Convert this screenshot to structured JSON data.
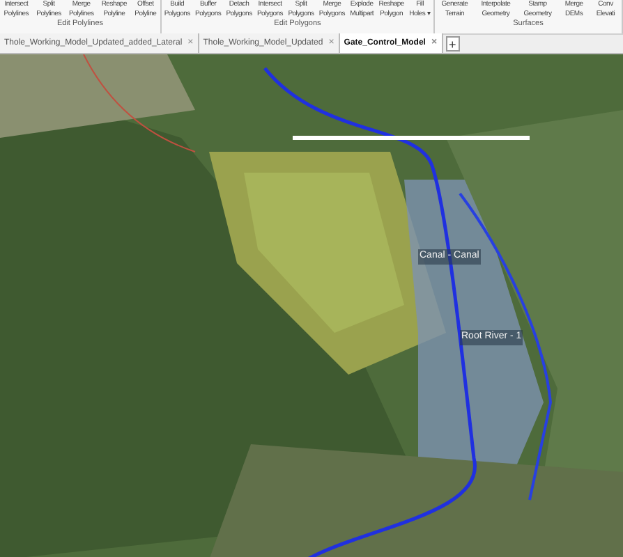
{
  "ribbon": {
    "groups": [
      {
        "label": "Edit Polylines",
        "buttons": [
          {
            "line1": "Intersect",
            "line2": "Polylines"
          },
          {
            "line1": "Split",
            "line2": "Polylines"
          },
          {
            "line1": "Merge",
            "line2": "Polylines"
          },
          {
            "line1": "Reshape",
            "line2": "Polyline"
          },
          {
            "line1": "Offset",
            "line2": "Polyline"
          }
        ]
      },
      {
        "label": "Edit Polygons",
        "buttons": [
          {
            "line1": "Build",
            "line2": "Polygons"
          },
          {
            "line1": "Buffer",
            "line2": "Polygons"
          },
          {
            "line1": "Detach",
            "line2": "Polygons"
          },
          {
            "line1": "Intersect",
            "line2": "Polygons"
          },
          {
            "line1": "Split",
            "line2": "Polygons"
          },
          {
            "line1": "Merge",
            "line2": "Polygons"
          },
          {
            "line1": "Explode",
            "line2": "Multipart"
          },
          {
            "line1": "Reshape",
            "line2": "Polygon"
          },
          {
            "line1": "Fill",
            "line2": "Holes ▾"
          }
        ]
      },
      {
        "label": "Surfaces",
        "buttons": [
          {
            "line1": "Generate",
            "line2": "Terrain"
          },
          {
            "line1": "Interpolate",
            "line2": "Geometry"
          },
          {
            "line1": "Stamp",
            "line2": "Geometry"
          },
          {
            "line1": "Merge",
            "line2": "DEMs"
          },
          {
            "line1": "Conv",
            "line2": "Elevati"
          }
        ]
      }
    ]
  },
  "tabs": [
    {
      "label": "Thole_Working_Model_Updated_added_Lateral",
      "close": "×",
      "selected": false
    },
    {
      "label": "Thole_Working_Model_Updated",
      "close": "×",
      "selected": false
    },
    {
      "label": "Gate_Control_Model",
      "close": "×",
      "selected": true
    }
  ],
  "add_tab": "+",
  "map": {
    "labels": [
      "Canal - Canal",
      "Root River - 1"
    ]
  }
}
